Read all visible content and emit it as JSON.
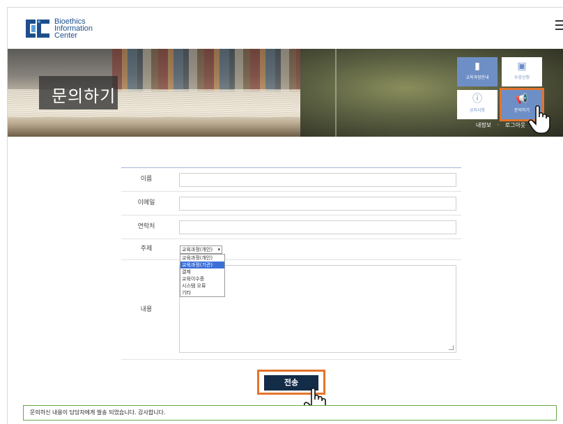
{
  "logo": {
    "line1": "Bioethics",
    "line2": "Information",
    "line3": "Center"
  },
  "banner": {
    "title": "문의하기"
  },
  "quick_menu": [
    {
      "label": "교육과정안내",
      "icon": "book-icon"
    },
    {
      "label": "수강신청",
      "icon": "monitor-icon"
    },
    {
      "label": "공지사항",
      "icon": "info-icon"
    },
    {
      "label": "문의하기",
      "icon": "megaphone-icon"
    }
  ],
  "user_links": {
    "my_info": "내정보",
    "separator": "·",
    "logout": "로그아웃"
  },
  "form": {
    "name_label": "이름",
    "email_label": "이메일",
    "phone_label": "연락처",
    "subject_label": "주제",
    "subject_selected": "교육과정(개인)",
    "subject_options": [
      "교육과정(개인)",
      "교육과정(기관)",
      "결제",
      "교육이수증",
      "시스템 오류",
      "기타"
    ],
    "subject_highlighted_index": 1,
    "content_label": "내용",
    "submit_label": "전송"
  },
  "status_message": "문의하신 내용이 담당자에게 발송 되었습니다. 감사합니다.",
  "colors": {
    "accent_outline": "#e4742c",
    "submit_bg": "#132c48",
    "quick_tile": "#6e8fc6",
    "status_border": "#65a84a"
  }
}
